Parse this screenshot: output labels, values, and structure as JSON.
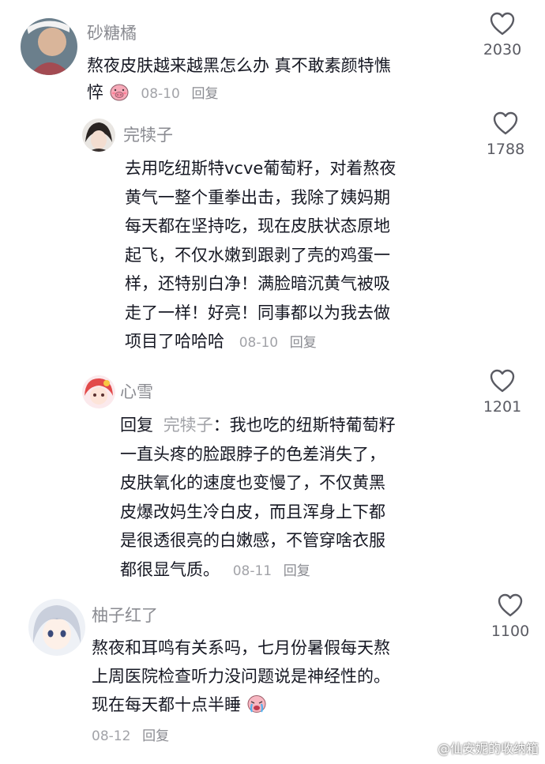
{
  "comments": [
    {
      "username": "砂糖橘",
      "lines": [
        "熬夜皮肤越来越黑怎么办 真不敢素颜特憔",
        "悴"
      ],
      "date": "08-10",
      "reply_label": "回复",
      "likes": "2030",
      "emoji": "pig-blushing-face"
    },
    {
      "username": "完犊子",
      "lines": [
        "去用吃纽斯特vcve葡萄籽，对着熬夜",
        "黄气一整个重拳出击，我除了姨妈期",
        "每天都在坚持吃，现在皮肤状态原地",
        "起飞，不仅水嫩到跟剥了壳的鸡蛋一",
        "样，还特别白净！满脸暗沉黄气被吸",
        "走了一样！好亮！同事都以为我去做",
        "项目了哈哈哈"
      ],
      "date": "08-10",
      "reply_label": "回复",
      "likes": "1788"
    },
    {
      "username": "心雪",
      "reply_prefix": "回复",
      "reply_to": "完犊子",
      "lines": [
        "：我也吃的纽斯特葡萄籽",
        "一直头疼的脸跟脖子的色差消失了，",
        "皮肤氧化的速度也变慢了，不仅黄黑",
        "皮爆改妈生冷白皮，而且浑身上下都",
        "是很透很亮的白嫩感，不管穿啥衣服",
        "都很显气质。"
      ],
      "date": "08-11",
      "reply_label": "回复",
      "likes": "1201"
    },
    {
      "username": "柚子红了",
      "lines": [
        "熬夜和耳鸣有关系吗，七月份暑假每天熬",
        "上周医院检查听力没问题说是神经性的。",
        "现在每天都十点半睡"
      ],
      "date": "08-12",
      "reply_label": "回复",
      "likes": "1100",
      "emoji": "crying-face"
    }
  ],
  "watermark": "@仙安妮的收纳箱",
  "icons": {
    "like": "heart-outline-icon"
  },
  "colors": {
    "username": "#8a8b91",
    "meta": "#a2a3a8",
    "text": "#161823"
  }
}
